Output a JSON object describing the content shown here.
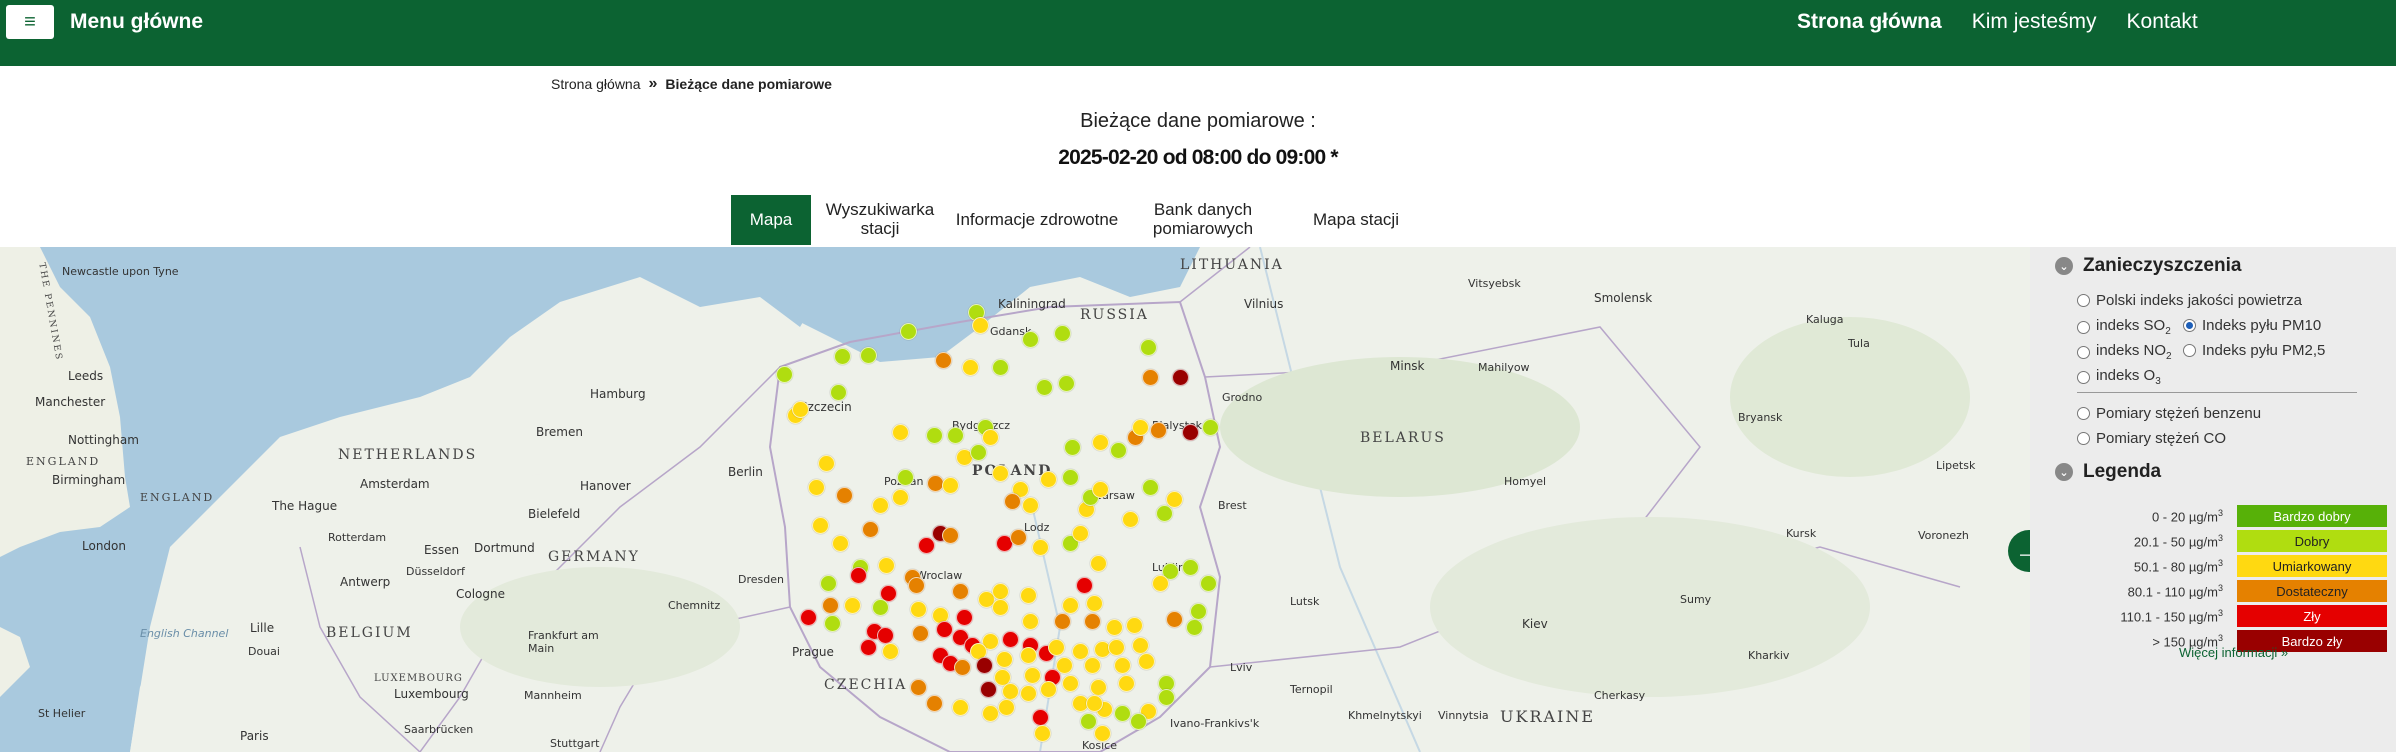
{
  "navbar": {
    "menu_title": "Menu główne",
    "links": [
      "Strona główna",
      "Kim jesteśmy",
      "Kontakt"
    ]
  },
  "breadcrumb": {
    "home": "Strona główna",
    "separator": "»",
    "current": "Bieżące dane pomiarowe"
  },
  "header": {
    "subtitle": "Bieżące dane pomiarowe :",
    "daterange": "2025-02-20 od 08:00 do 09:00 *"
  },
  "tabs": [
    "Mapa",
    "Wyszukiwarka stacji",
    "Informacje zdrowotne",
    "Bank danych pomiarowych",
    "Mapa stacji"
  ],
  "map": {
    "countries": [
      "LITHUANIA",
      "RUSSIA",
      "BELARUS",
      "NETHERLANDS",
      "GERMANY",
      "POLAND",
      "BELGIUM",
      "CZECHIA",
      "UKRAINE",
      "ENGLAND",
      "ENGLAND",
      "LUXEMBOURG",
      "THE PENNINES"
    ],
    "cities": [
      "Newcastle upon Tyne",
      "Leeds",
      "Manchester",
      "Nottingham",
      "Birmingham",
      "London",
      "Hamburg",
      "Szczecin",
      "Bremen",
      "Amsterdam",
      "The Hague",
      "Rotterdam",
      "Hanover",
      "Berlin",
      "Bielefeld",
      "Essen",
      "Dortmund",
      "Düsseldorf",
      "Cologne",
      "Antwerp",
      "Lille",
      "Douai",
      "Luxembourg",
      "Saarbrücken",
      "Paris",
      "St Helier",
      "Stuttgart",
      "Frankfurt am Main",
      "Mannheim",
      "Chemnitz",
      "Dresden",
      "Prague",
      "Kaliningrad",
      "Gdansk",
      "Bydgoszcz",
      "Poznan",
      "Lodz",
      "Warsaw",
      "Wroclaw",
      "Lublin",
      "Bialystok",
      "Vilnius",
      "Grodno",
      "Minsk",
      "Mahilyow",
      "Vitsyebsk",
      "Smolensk",
      "Kaluga",
      "Tula",
      "Bryansk",
      "Homyel",
      "Lipetsk",
      "Kursk",
      "Voronezh",
      "Sumy",
      "Kharkiv",
      "Kiev",
      "Lutsk",
      "Lviv",
      "Ternopil",
      "Khmelnytskyi",
      "Vinnytsia",
      "Cherkasy",
      "Brest",
      "Kosice",
      "Ivano-Frankivs'k"
    ],
    "seas": [
      "English Channel"
    ],
    "colors": {
      "very_good": "#57b108",
      "good": "#b0dd10",
      "moderate": "#ffd911",
      "sufficient": "#e58100",
      "bad": "#e50000",
      "very_bad": "#990000"
    }
  },
  "panel": {
    "pollutants_title": "Zanieczyszczenia",
    "options": {
      "aqi": "Polski indeks jakości powietrza",
      "so2": "indeks SO",
      "so2_sub": "2",
      "pm10": "Indeks pyłu PM10",
      "no2": "indeks NO",
      "no2_sub": "2",
      "pm25": "Indeks pyłu PM2,5",
      "o3": "indeks O",
      "o3_sub": "3",
      "benzene": "Pomiary stężeń benzenu",
      "co": "Pomiary stężeń CO"
    },
    "selected": "pm10",
    "legend_title": "Legenda",
    "unit": "µg/m",
    "unit_sup": "3",
    "legend": [
      {
        "range": "0 - 20 ",
        "label": "Bardzo dobry",
        "color": "#57b108",
        "text_color": "#ffffff"
      },
      {
        "range": "20.1 - 50 ",
        "label": "Dobry",
        "color": "#b0dd10",
        "text_color": "#222222"
      },
      {
        "range": "50.1 - 80 ",
        "label": "Umiarkowany",
        "color": "#ffd911",
        "text_color": "#222222"
      },
      {
        "range": "80.1 - 110 ",
        "label": "Dostateczny",
        "color": "#e58100",
        "text_color": "#222222"
      },
      {
        "range": "110.1 - 150 ",
        "label": "Zły",
        "color": "#e50000",
        "text_color": "#ffffff"
      },
      {
        "range": "> 150 ",
        "label": "Bardzo zły",
        "color": "#990000",
        "text_color": "#ffffff"
      }
    ],
    "more_link": "Więcej informacji »"
  }
}
